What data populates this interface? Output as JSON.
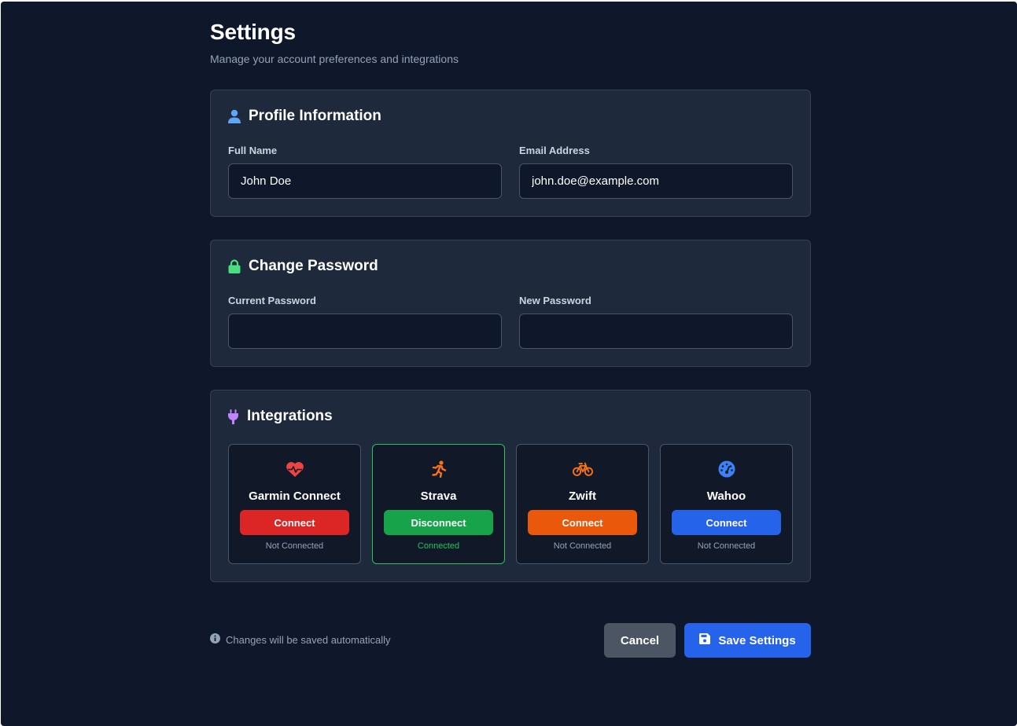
{
  "page": {
    "title": "Settings",
    "subtitle": "Manage your account preferences and integrations"
  },
  "profile": {
    "title": "Profile Information",
    "icon": "user-icon",
    "full_name_label": "Full Name",
    "full_name_value": "John Doe",
    "email_label": "Email Address",
    "email_value": "john.doe@example.com"
  },
  "password": {
    "title": "Change Password",
    "icon": "lock-icon",
    "current_label": "Current Password",
    "current_value": "",
    "new_label": "New Password",
    "new_value": ""
  },
  "integrations": {
    "title": "Integrations",
    "icon": "plug-icon",
    "items": [
      {
        "name": "Garmin Connect",
        "icon": "heart-pulse-icon",
        "button": "Connect",
        "status": "Not Connected",
        "color": "#dc2626",
        "icon_color": "#ef4444"
      },
      {
        "name": "Strava",
        "icon": "running-icon",
        "button": "Disconnect",
        "status": "Connected",
        "color": "#16a34a",
        "icon_color": "#f97316"
      },
      {
        "name": "Zwift",
        "icon": "bicycle-icon",
        "button": "Connect",
        "status": "Not Connected",
        "color": "#ea580c",
        "icon_color": "#f97316"
      },
      {
        "name": "Wahoo",
        "icon": "gauge-icon",
        "button": "Connect",
        "status": "Not Connected",
        "color": "#2563eb",
        "icon_color": "#3b82f6"
      }
    ]
  },
  "footer": {
    "note": "Changes will be saved automatically",
    "cancel_label": "Cancel",
    "save_label": "Save Settings"
  },
  "colors": {
    "background": "#0f172a",
    "card": "#1e293b",
    "accent": "#2563eb",
    "success": "#22c55e"
  }
}
